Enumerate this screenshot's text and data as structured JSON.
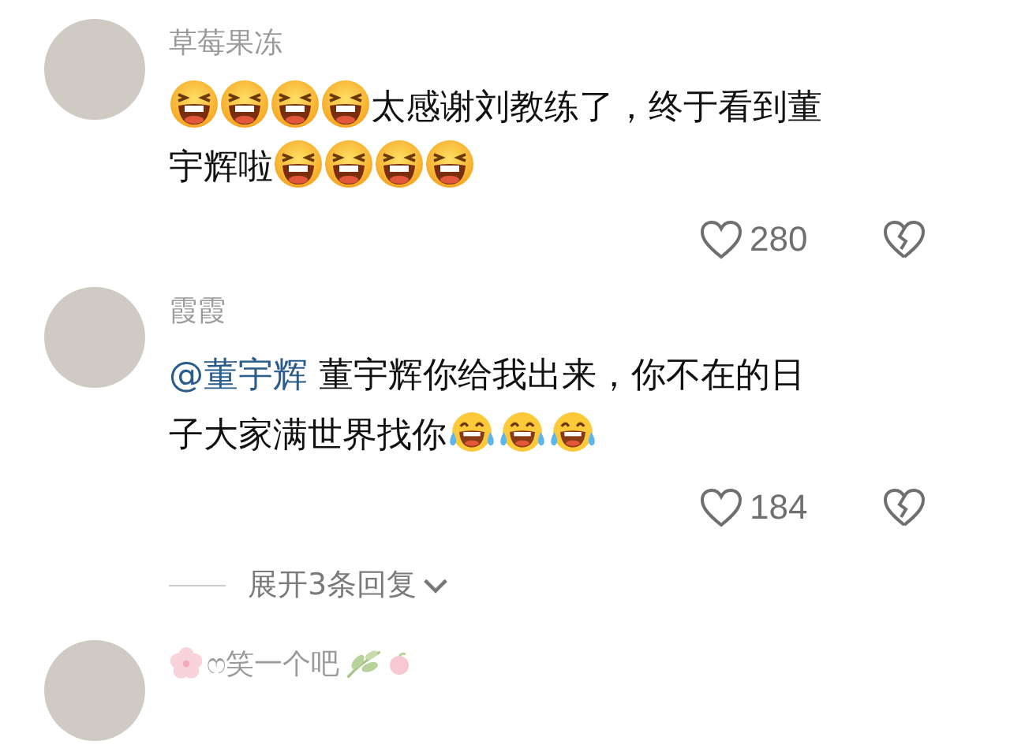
{
  "comments": [
    {
      "username": "草莓果冻",
      "name_decor": false,
      "lines": [
        [
          {
            "kind": "grin"
          },
          {
            "kind": "grin"
          },
          {
            "kind": "grin"
          },
          {
            "kind": "grin"
          },
          {
            "kind": "text",
            "text": "太感谢刘教练了，终于看到董"
          }
        ],
        [
          {
            "kind": "text",
            "text": "宇辉啦"
          },
          {
            "kind": "grin"
          },
          {
            "kind": "grin"
          },
          {
            "kind": "grin"
          },
          {
            "kind": "grin"
          }
        ]
      ],
      "likes": "280"
    },
    {
      "username": "霞霞",
      "name_decor": false,
      "lines": [
        [
          {
            "kind": "mention",
            "text": "@董宇辉"
          },
          {
            "kind": "text",
            "text": " 董宇辉你给我出来，你不在的日"
          }
        ],
        [
          {
            "kind": "text",
            "text": "子大家满世界找你"
          },
          {
            "kind": "tears"
          },
          {
            "kind": "tears"
          },
          {
            "kind": "tears"
          }
        ]
      ],
      "likes": "184",
      "replies": "展开3条回复"
    },
    {
      "username": "ෆ笑一个吧",
      "name_decor": true
    }
  ]
}
